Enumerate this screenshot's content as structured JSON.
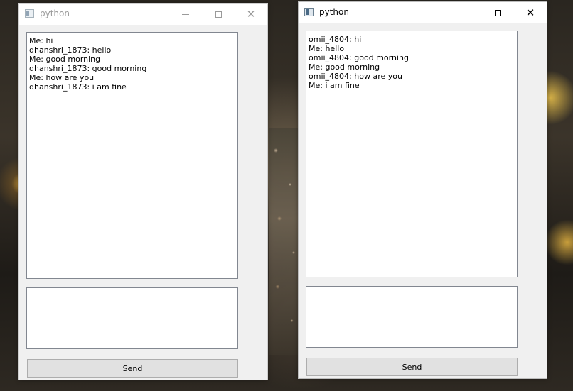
{
  "windows": {
    "left": {
      "title": "python",
      "messages": [
        "Me: hi",
        "dhanshri_1873: hello",
        "Me: good morning",
        "dhanshri_1873: good morning",
        "Me: how are you",
        "dhanshri_1873: i am fine"
      ],
      "input_value": "",
      "send_label": "Send",
      "icons": {
        "app": "app-window-icon",
        "minimize": "minimize-icon",
        "maximize": "maximize-icon",
        "close": "close-icon"
      }
    },
    "right": {
      "title": "python",
      "messages": [
        "omii_4804: hi",
        "Me: hello",
        "omii_4804: good morning",
        "Me: good morning",
        "omii_4804: how are you",
        "Me: i am fine"
      ],
      "input_value": "",
      "send_label": "Send",
      "icons": {
        "app": "app-window-icon",
        "minimize": "minimize-icon",
        "maximize": "maximize-icon",
        "close": "close-icon"
      }
    }
  },
  "colors": {
    "window_bg": "#f0f0f0",
    "titlebar_bg": "#ffffff",
    "inactive_title": "#9a9a9a",
    "button_bg": "#e1e1e1",
    "field_border": "#828790"
  }
}
